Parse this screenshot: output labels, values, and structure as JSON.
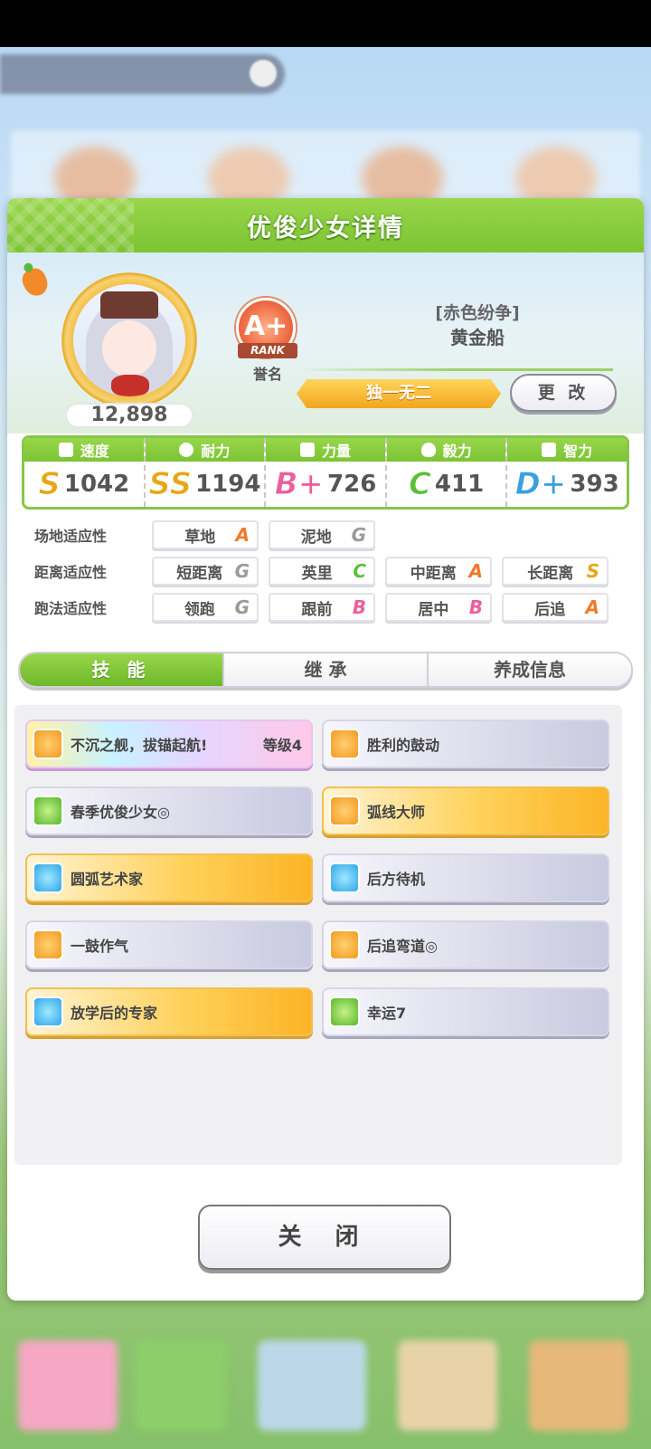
{
  "dialog": {
    "title": "优俊少女详情"
  },
  "profile": {
    "score": "12,898",
    "rank_grade": "A+",
    "rank_ribbon": "RANK",
    "rank_label": "誉名",
    "title": "[赤色纷争]",
    "name": "黄金船",
    "epithet": "独一无二",
    "change_label": "更 改"
  },
  "stats": [
    {
      "label": "速度",
      "grade": "S",
      "value": "1042",
      "color": "#e6a717",
      "icon": "shoe-icon"
    },
    {
      "label": "耐力",
      "grade": "SS",
      "value": "1194",
      "color": "#e6a717",
      "icon": "heart-icon"
    },
    {
      "label": "力量",
      "grade": "B+",
      "value": "726",
      "color": "#ec5e9c",
      "icon": "muscle-icon"
    },
    {
      "label": "毅力",
      "grade": "C",
      "value": "411",
      "color": "#5bbf3a",
      "icon": "flame-icon"
    },
    {
      "label": "智力",
      "grade": "D+",
      "value": "393",
      "color": "#3aa0de",
      "icon": "graduation-cap-icon"
    }
  ],
  "aptitude": {
    "track": {
      "label": "场地适应性",
      "cells": [
        {
          "name": "草地",
          "grade": "A",
          "color": "#f07a2a"
        },
        {
          "name": "泥地",
          "grade": "G",
          "color": "#9a9a9a"
        }
      ]
    },
    "distance": {
      "label": "距离适应性",
      "cells": [
        {
          "name": "短距离",
          "grade": "G",
          "color": "#9a9a9a"
        },
        {
          "name": "英里",
          "grade": "C",
          "color": "#5bbf3a"
        },
        {
          "name": "中距离",
          "grade": "A",
          "color": "#f07a2a"
        },
        {
          "name": "长距离",
          "grade": "S",
          "color": "#e6a717"
        }
      ]
    },
    "style": {
      "label": "跑法适应性",
      "cells": [
        {
          "name": "领跑",
          "grade": "G",
          "color": "#9a9a9a"
        },
        {
          "name": "跟前",
          "grade": "B",
          "color": "#ec5e9c"
        },
        {
          "name": "居中",
          "grade": "B",
          "color": "#ec5e9c"
        },
        {
          "name": "后追",
          "grade": "A",
          "color": "#f07a2a"
        }
      ]
    }
  },
  "tabs": [
    {
      "label": "技 能"
    },
    {
      "label": "继 承"
    },
    {
      "label": "养成信息"
    }
  ],
  "skills": [
    {
      "name": "不沉之舰，拔锚起航!",
      "level": "等级4",
      "style": "rainbow",
      "icon": "orange"
    },
    {
      "name": "胜利的鼓动",
      "level": "",
      "style": "gray",
      "icon": "orange"
    },
    {
      "name": "春季优俊少女◎",
      "level": "",
      "style": "gray",
      "icon": "green"
    },
    {
      "name": "弧线大师",
      "level": "",
      "style": "gold",
      "icon": "orange"
    },
    {
      "name": "圆弧艺术家",
      "level": "",
      "style": "gold",
      "icon": "blue"
    },
    {
      "name": "后方待机",
      "level": "",
      "style": "gray",
      "icon": "blue"
    },
    {
      "name": "一鼓作气",
      "level": "",
      "style": "gray",
      "icon": "orange"
    },
    {
      "name": "后追弯道◎",
      "level": "",
      "style": "gray",
      "icon": "orange"
    },
    {
      "name": "放学后的专家",
      "level": "",
      "style": "gold",
      "icon": "blue"
    },
    {
      "name": "幸运7",
      "level": "",
      "style": "gray",
      "icon": "green"
    }
  ],
  "close_label": "关 闭"
}
